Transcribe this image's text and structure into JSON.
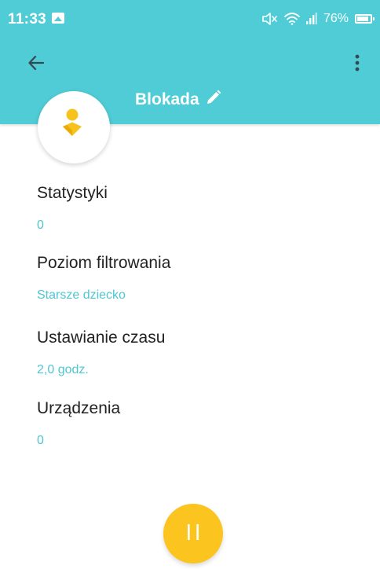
{
  "status_bar": {
    "time": "11:33",
    "battery_percent": "76%",
    "icons": [
      "gallery-icon",
      "muted-speaker-icon",
      "wifi-icon",
      "signal-icon",
      "battery-icon"
    ]
  },
  "app_bar": {
    "title": "Blokada",
    "icons": [
      "back-arrow-icon",
      "edit-pencil-icon",
      "more-vert-icon"
    ]
  },
  "avatar": {
    "icon": "child-figure-icon",
    "colors": {
      "figure": "#f7c21b"
    }
  },
  "sections": [
    {
      "label": "Statystyki",
      "value": "0"
    },
    {
      "label": "Poziom filtrowania",
      "value": "Starsze dziecko"
    },
    {
      "label": "Ustawianie czasu",
      "value": "2,0 godz."
    },
    {
      "label": "Urządzenia",
      "value": "0"
    }
  ],
  "fab": {
    "icon": "pause-icon",
    "color": "#fcc41e"
  },
  "colors": {
    "accent": "#4fccd6",
    "value_text": "#4fc6d1"
  }
}
